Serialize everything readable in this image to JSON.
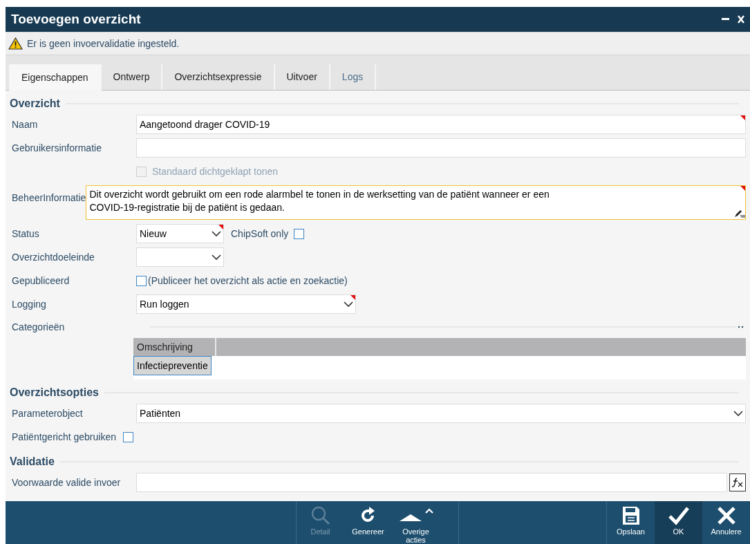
{
  "window": {
    "title": "Toevoegen overzicht"
  },
  "warning": "Er is geen invoervalidatie ingesteld.",
  "tabs": [
    {
      "label": "Eigenschappen",
      "selected": true,
      "disabled": false
    },
    {
      "label": "Ontwerp",
      "selected": false,
      "disabled": false
    },
    {
      "label": "Overzichtsexpressie",
      "selected": false,
      "disabled": false
    },
    {
      "label": "Uitvoer",
      "selected": false,
      "disabled": false
    },
    {
      "label": "Logs",
      "selected": false,
      "disabled": true
    }
  ],
  "sections": [
    {
      "title": "Overzicht",
      "rows": [
        {
          "kind": "text",
          "label": "Naam",
          "value": "Aangetoond drager COVID-19",
          "required": true
        },
        {
          "kind": "text",
          "label": "Gebruikersinformatie",
          "required": false
        },
        {
          "kind": "checkbox",
          "text": "Standaard dichtgeklapt tonen",
          "checked": false,
          "disabled": true
        },
        {
          "kind": "textarea",
          "label": "BeheerInformatie",
          "lines": [
            "Dit overzicht wordt gebruikt om een rode alarmbel te tonen in de werksetting van de patiënt wanneer er een",
            "COVID-19-registratie bij de patiënt is gedaan."
          ],
          "required": true
        },
        {
          "kind": "select-short",
          "label": "Status",
          "value": "Nieuw",
          "required": true,
          "extra": {
            "label": "ChipSoft only",
            "checked": false
          }
        },
        {
          "kind": "select-short",
          "label": "Overzichtdoeleinde",
          "required": false
        },
        {
          "kind": "checkbox",
          "label": "Gepubliceerd",
          "text": "(Publiceer het overzicht als actie en zoekactie)",
          "checked": false,
          "disabled": false
        },
        {
          "kind": "select-medium",
          "label": "Logging",
          "value": "Run loggen",
          "required": true
        },
        {
          "kind": "list",
          "label": "Categorieën",
          "column": "Omschrijving",
          "items": [
            {
              "text": "Infectiepreventie",
              "selected": true
            }
          ]
        }
      ]
    },
    {
      "title": "Overzichtsopties",
      "rows": [
        {
          "kind": "select-full",
          "label": "Parameterobject",
          "value": "Patiënten",
          "required": false
        },
        {
          "kind": "checkbox-inline",
          "label": "Patiëntgericht gebruiken",
          "checked": false
        }
      ]
    },
    {
      "title": "Validatie",
      "rows": [
        {
          "kind": "formula",
          "label": "Voorwaarde valide invoer"
        }
      ]
    }
  ],
  "footer": {
    "left": [
      {
        "kind": "search",
        "label": "Detail",
        "disabled": true,
        "selected": false
      },
      {
        "kind": "refresh",
        "label": "Genereer",
        "disabled": false,
        "selected": false
      },
      {
        "kind": "more",
        "label": "Overige acties",
        "disabled": false,
        "selected": false
      }
    ],
    "right": [
      {
        "kind": "save",
        "label": "Opslaan",
        "disabled": false,
        "selected": false
      },
      {
        "kind": "check",
        "label": "OK",
        "disabled": false,
        "selected": true
      },
      {
        "kind": "cancel",
        "label": "Annulere",
        "disabled": false,
        "selected": false
      }
    ]
  }
}
